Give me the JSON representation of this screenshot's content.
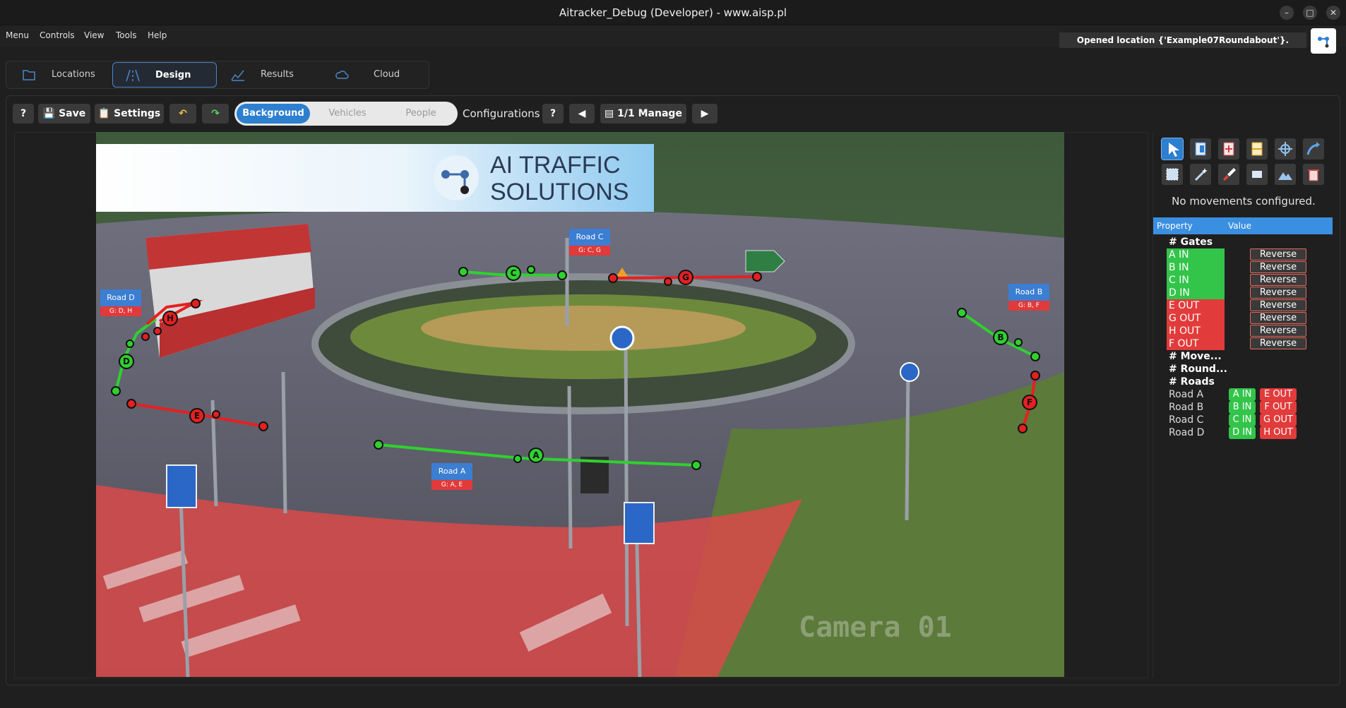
{
  "window": {
    "title": "Aitracker_Debug (Developer) - www.aisp.pl"
  },
  "menu": [
    "Menu",
    "Controls",
    "View",
    "Tools",
    "Help"
  ],
  "status_message": "Opened location {'Example07Roundabout'}.",
  "tabs": [
    {
      "label": "Locations",
      "icon": "folder-icon"
    },
    {
      "label": "Design",
      "icon": "road-icon"
    },
    {
      "label": "Results",
      "icon": "chart-icon"
    },
    {
      "label": "Cloud",
      "icon": "cloud-icon"
    }
  ],
  "toolbar": {
    "help": "?",
    "save": "Save",
    "settings": "Settings",
    "segments": [
      "Background",
      "Vehicles",
      "People"
    ],
    "configurations_label": "Configurations :",
    "config_help": "?",
    "manage": "1/1 Manage"
  },
  "scene": {
    "banner": {
      "line1": "AI TRAFFIC",
      "line2": "SOLUTIONS"
    },
    "watermark": "Camera 01",
    "roads": [
      {
        "name": "Road C",
        "gates": "G: C, G"
      },
      {
        "name": "Road D",
        "gates": "G: D, H"
      },
      {
        "name": "Road B",
        "gates": "G: B, F"
      },
      {
        "name": "Road A",
        "gates": "G: A, E"
      }
    ],
    "gates": [
      "A",
      "B",
      "C",
      "D",
      "E",
      "F",
      "G",
      "H"
    ]
  },
  "right_panel": {
    "no_movements": "No movements configured.",
    "columns": [
      "Property",
      "Value"
    ],
    "gates_header": "# Gates",
    "gates": [
      {
        "label": "A IN",
        "kind": "in"
      },
      {
        "label": "B IN",
        "kind": "in"
      },
      {
        "label": "C IN",
        "kind": "in"
      },
      {
        "label": "D IN",
        "kind": "in"
      },
      {
        "label": "E OUT",
        "kind": "out"
      },
      {
        "label": "G OUT",
        "kind": "out"
      },
      {
        "label": "H OUT",
        "kind": "out"
      },
      {
        "label": "F OUT",
        "kind": "out"
      }
    ],
    "reverse_label": "Reverse",
    "movements_header": "# Move...",
    "roundabout_header": "# Round...",
    "roads_header": "# Roads",
    "roads": [
      {
        "name": "Road A",
        "in": "A IN",
        "out": "E OUT"
      },
      {
        "name": "Road B",
        "in": "B IN",
        "out": "F OUT"
      },
      {
        "name": "Road C",
        "in": "C IN",
        "out": "G OUT"
      },
      {
        "name": "Road D",
        "in": "D IN",
        "out": "H OUT"
      }
    ]
  },
  "colors": {
    "accent": "#2d7fd0",
    "in_gate": "#33c44a",
    "out_gate": "#e23b3b"
  }
}
